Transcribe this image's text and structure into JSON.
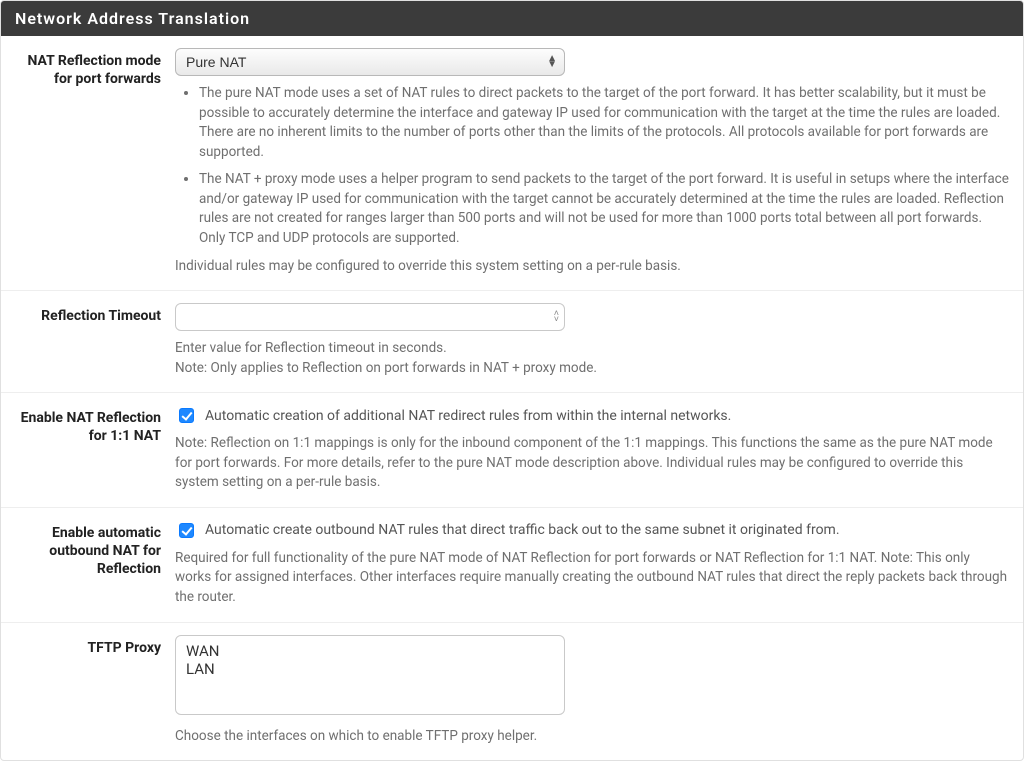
{
  "panel": {
    "title": "Network Address Translation"
  },
  "nat_mode": {
    "label": "NAT Reflection mode for port forwards",
    "value": "Pure NAT",
    "bullet1": "The pure NAT mode uses a set of NAT rules to direct packets to the target of the port forward. It has better scalability, but it must be possible to accurately determine the interface and gateway IP used for communication with the target at the time the rules are loaded. There are no inherent limits to the number of ports other than the limits of the protocols. All protocols available for port forwards are supported.",
    "bullet2": "The NAT + proxy mode uses a helper program to send packets to the target of the port forward. It is useful in setups where the interface and/or gateway IP used for communication with the target cannot be accurately determined at the time the rules are loaded. Reflection rules are not created for ranges larger than 500 ports and will not be used for more than 1000 ports total between all port forwards. Only TCP and UDP protocols are supported.",
    "footer": "Individual rules may be configured to override this system setting on a per-rule basis."
  },
  "reflection_timeout": {
    "label": "Reflection Timeout",
    "value": "",
    "help1": "Enter value for Reflection timeout in seconds.",
    "help2": "Note: Only applies to Reflection on port forwards in NAT + proxy mode."
  },
  "reflection_1to1": {
    "label": "Enable NAT Reflection for 1:1 NAT",
    "checkbox_label": "Automatic creation of additional NAT redirect rules from within the internal networks.",
    "help": "Note: Reflection on 1:1 mappings is only for the inbound component of the 1:1 mappings. This functions the same as the pure NAT mode for port forwards. For more details, refer to the pure NAT mode description above. Individual rules may be configured to override this system setting on a per-rule basis."
  },
  "auto_outbound": {
    "label": "Enable automatic outbound NAT for Reflection",
    "checkbox_label": "Automatic create outbound NAT rules that direct traffic back out to the same subnet it originated from.",
    "help": "Required for full functionality of the pure NAT mode of NAT Reflection for port forwards or NAT Reflection for 1:1 NAT. Note: This only works for assigned interfaces. Other interfaces require manually creating the outbound NAT rules that direct the reply packets back through the router."
  },
  "tftp_proxy": {
    "label": "TFTP Proxy",
    "options_text": "WAN\nLAN",
    "help": "Choose the interfaces on which to enable TFTP proxy helper."
  }
}
